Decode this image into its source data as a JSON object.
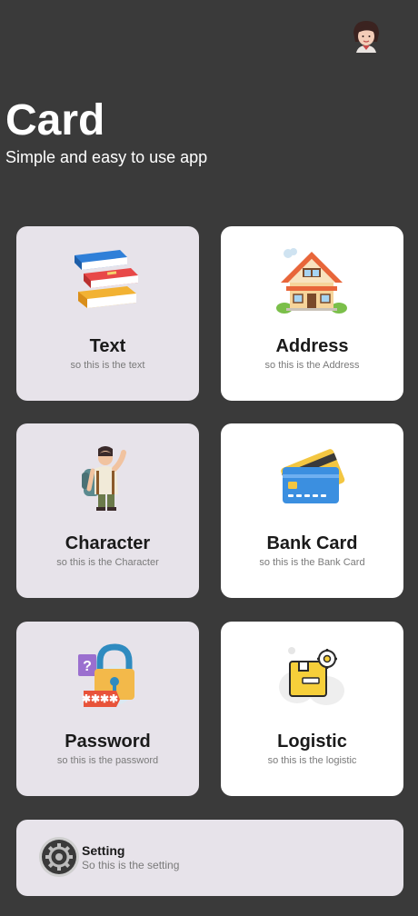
{
  "header": {
    "title": "Card",
    "subtitle": "Simple and easy to use app"
  },
  "cards": [
    {
      "title": "Text",
      "subtitle": "so this is the text",
      "icon": "books-icon"
    },
    {
      "title": "Address",
      "subtitle": "so this is the Address",
      "icon": "house-icon"
    },
    {
      "title": "Character",
      "subtitle": "so this is the Character",
      "icon": "traveler-icon"
    },
    {
      "title": "Bank Card",
      "subtitle": "so this is the Bank Card",
      "icon": "credit-card-icon"
    },
    {
      "title": "Password",
      "subtitle": "so this is the password",
      "icon": "padlock-icon"
    },
    {
      "title": "Logistic",
      "subtitle": "so this is the logistic",
      "icon": "package-icon"
    }
  ],
  "setting": {
    "title": "Setting",
    "subtitle": "So this is the setting",
    "icon": "gear-icon"
  },
  "colors": {
    "background": "#3a3a3a",
    "card_grey": "#e7e3ea",
    "card_white": "#ffffff"
  }
}
